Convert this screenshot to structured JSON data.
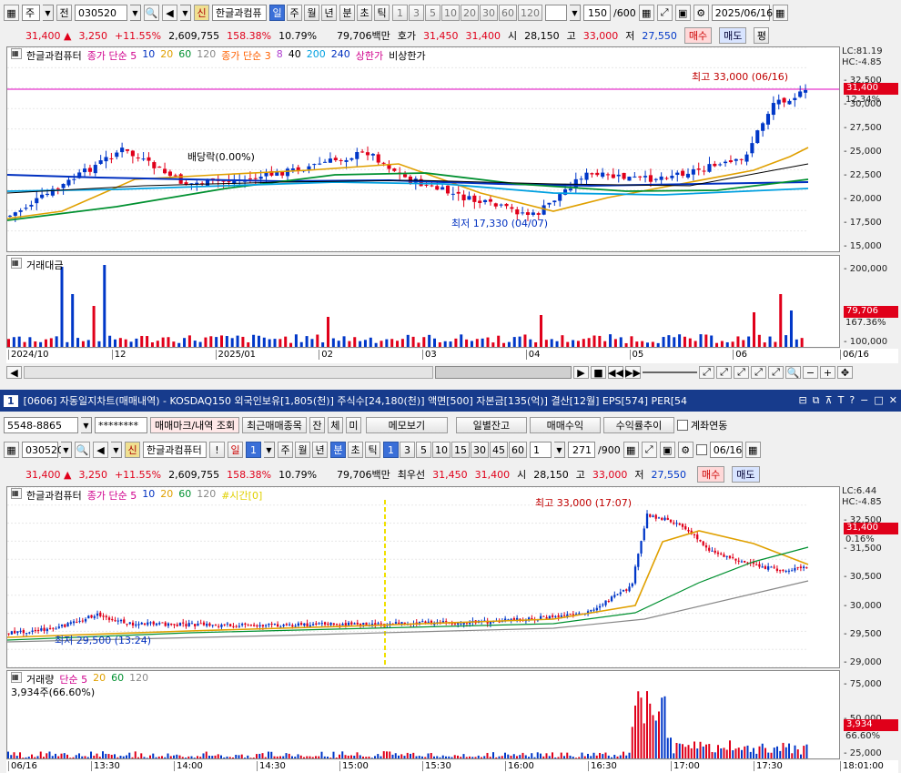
{
  "top": {
    "tool": {
      "type_label": "주",
      "period_label": "전",
      "code": "030520",
      "shin_badge": "신",
      "name": "한글과컴퓨",
      "periods": [
        "일",
        "주",
        "월",
        "년"
      ],
      "selected_period": "일",
      "intraday": [
        "분",
        "초",
        "틱"
      ],
      "numbers": [
        "1",
        "3",
        "5",
        "10",
        "20",
        "30",
        "60",
        "120"
      ],
      "count": "150",
      "count_max": "/600",
      "date": "2025/06/16"
    },
    "quote": {
      "price": "31,400",
      "arrow": "▲",
      "change": "3,250",
      "pct": "+11.55%",
      "volume": "2,609,755",
      "vol_ratio": "158.38%",
      "turnover": "10.79%",
      "amount": "79,706백만",
      "bid_label": "호가",
      "ask": "31,450",
      "bid": "31,400",
      "open_label": "시",
      "open": "28,150",
      "high_label": "고",
      "high": "33,000",
      "low_label": "저",
      "low": "27,550",
      "buy": "매수",
      "sell": "매도",
      "avg": "평"
    },
    "legend": [
      {
        "text": "한글과컴퓨터",
        "color": "#000000"
      },
      {
        "text": "종가 단순 5",
        "color": "#d0008c"
      },
      {
        "text": "10",
        "color": "#0030c0"
      },
      {
        "text": "20",
        "color": "#e0a000"
      },
      {
        "text": "60",
        "color": "#009030"
      },
      {
        "text": "120",
        "color": "#888888"
      },
      {
        "text": "종가 단순 3",
        "color": "#ff6000"
      },
      {
        "text": "8",
        "color": "#b040d0"
      },
      {
        "text": "40",
        "color": "#000000"
      },
      {
        "text": "200",
        "color": "#00a0e0"
      },
      {
        "text": "240",
        "color": "#0030c0"
      },
      {
        "text": "상한가",
        "color": "#d0008c"
      },
      {
        "text": "비상한가",
        "color": "#000000"
      }
    ],
    "lc": "LC:81.19",
    "hc": "HC:-4.85",
    "price_box": "31,400",
    "price_pct": "12.34%",
    "yticks": [
      "32,500",
      "30,000",
      "27,500",
      "25,000",
      "22,500",
      "20,000",
      "17,500",
      "15,000"
    ],
    "ann_high": "최고 33,000 (06/16)",
    "ann_low": "최저 17,330 (04/07)",
    "ann_div": "배당락(0.00%)",
    "vol_label": "거래대금",
    "vol_ticks": [
      "200,000",
      "100,000"
    ],
    "vol_box": "79,706",
    "vol_pct": "167.36%",
    "xticks": [
      "2024/10",
      "12",
      "2025/01",
      "02",
      "03",
      "04",
      "05",
      "06",
      "06/16"
    ]
  },
  "bottom": {
    "title": "[0606] 자동일지차트(매매내역) - KOSDAQ150 외국인보유[1,805(천)] 주식수[24,180(천)] 액면[500] 자본금[135(억)] 결산[12월] EPS[574] PER[54",
    "win_no": "1",
    "account": "5548-8865",
    "password": "********",
    "btns": [
      "매매마크/내역 조회",
      "최근매매종목",
      "잔",
      "체",
      "미",
      "메모보기",
      "일별잔고",
      "매매수익",
      "수익률추이"
    ],
    "account_link": "계좌연동",
    "tool": {
      "code": "030520",
      "shin_badge": "신",
      "name": "한글과컴퓨터",
      "excl": "!",
      "period": "일",
      "period_num": "1",
      "periods": [
        "주",
        "월",
        "년"
      ],
      "intraday": [
        "분",
        "초",
        "틱"
      ],
      "selected_intraday": "분",
      "numbers": [
        "1",
        "3",
        "5",
        "10",
        "15",
        "30",
        "45",
        "60"
      ],
      "selected_number": "1",
      "unit": "1",
      "count": "271",
      "count_max": "/900",
      "date": "06/16"
    },
    "quote": {
      "price": "31,400",
      "arrow": "▲",
      "change": "3,250",
      "pct": "+11.55%",
      "volume": "2,609,755",
      "vol_ratio": "158.38%",
      "turnover": "10.79%",
      "amount": "79,706백만",
      "bid_label": "최우선",
      "ask": "31,450",
      "bid": "31,400",
      "open_label": "시",
      "open": "28,150",
      "high_label": "고",
      "high": "33,000",
      "low_label": "저",
      "low": "27,550",
      "buy": "매수",
      "sell": "매도"
    },
    "legend": [
      {
        "text": "한글과컴퓨터",
        "color": "#000000"
      },
      {
        "text": "종가 단순 5",
        "color": "#d0008c"
      },
      {
        "text": "10",
        "color": "#0030c0"
      },
      {
        "text": "20",
        "color": "#e0a000"
      },
      {
        "text": "60",
        "color": "#009030"
      },
      {
        "text": "120",
        "color": "#888888"
      },
      {
        "text": "#시간[0]",
        "color": "#e0d000"
      }
    ],
    "lc": "LC:6.44",
    "hc": "HC:-4.85",
    "price_box": "31,400",
    "price_pct": "0.16%",
    "yticks": [
      "32,500",
      "31,500",
      "30,500",
      "30,000",
      "29,500",
      "29,000"
    ],
    "ann_high": "최고 33,000 (17:07)",
    "ann_low": "최저 29,500 (13:24)",
    "vol_legend": [
      {
        "text": "거래량",
        "color": "#000000"
      },
      {
        "text": "단순 5",
        "color": "#d0008c"
      },
      {
        "text": "20",
        "color": "#e0a000"
      },
      {
        "text": "60",
        "color": "#009030"
      },
      {
        "text": "120",
        "color": "#888888"
      }
    ],
    "vol_summary": "3,934주(66.60%)",
    "vol_ticks": [
      "75,000",
      "50,000",
      "25,000"
    ],
    "vol_box": "3,934",
    "vol_pct": "66.60%",
    "xticks": [
      "06/16",
      "13:30",
      "14:00",
      "14:30",
      "15:00",
      "15:30",
      "16:00",
      "16:30",
      "17:00",
      "17:30",
      "18:01:00"
    ]
  },
  "colors": {
    "up": "#e0001a",
    "down": "#0037c8",
    "title_bar": "#173b8c"
  }
}
